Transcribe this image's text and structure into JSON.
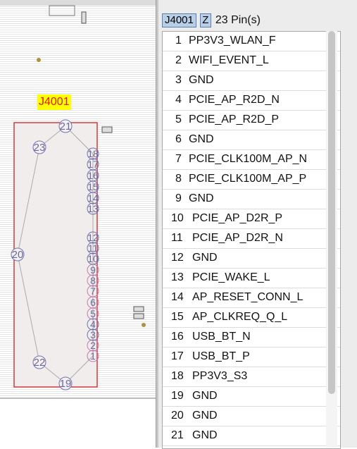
{
  "panel": {
    "component_ref": "J4001",
    "z_button": "Z",
    "pin_count_label": "23 Pin(s)"
  },
  "board": {
    "component_label": "J4001"
  },
  "pins": [
    {
      "num": "1",
      "name": "PP3V3_WLAN_F"
    },
    {
      "num": "2",
      "name": "WIFI_EVENT_L"
    },
    {
      "num": "3",
      "name": "GND"
    },
    {
      "num": "4",
      "name": "PCIE_AP_R2D_N"
    },
    {
      "num": "5",
      "name": "PCIE_AP_R2D_P"
    },
    {
      "num": "6",
      "name": "GND"
    },
    {
      "num": "7",
      "name": "PCIE_CLK100M_AP_N"
    },
    {
      "num": "8",
      "name": "PCIE_CLK100M_AP_P"
    },
    {
      "num": "9",
      "name": "GND"
    },
    {
      "num": "10",
      "name": "PCIE_AP_D2R_P"
    },
    {
      "num": "11",
      "name": "PCIE_AP_D2R_N"
    },
    {
      "num": "12",
      "name": "GND"
    },
    {
      "num": "13",
      "name": "PCIE_WAKE_L"
    },
    {
      "num": "14",
      "name": "AP_RESET_CONN_L"
    },
    {
      "num": "15",
      "name": "AP_CLKREQ_Q_L"
    },
    {
      "num": "16",
      "name": "USB_BT_N"
    },
    {
      "num": "17",
      "name": "USB_BT_P"
    },
    {
      "num": "18",
      "name": "PP3V3_S3"
    },
    {
      "num": "19",
      "name": "GND"
    },
    {
      "num": "20",
      "name": "GND"
    },
    {
      "num": "21",
      "name": "GND"
    }
  ],
  "pad_labels": [
    "1",
    "2",
    "3",
    "4",
    "5",
    "6",
    "7",
    "8",
    "9",
    "10",
    "11",
    "12",
    "13",
    "14",
    "15",
    "16",
    "17",
    "18",
    "19",
    "20",
    "21",
    "22",
    "23"
  ],
  "colors": {
    "component_outline": "#d23c3c",
    "label_bg": "#ffff00",
    "label_text": "#e01818",
    "pad_ring": "#7070b0"
  }
}
